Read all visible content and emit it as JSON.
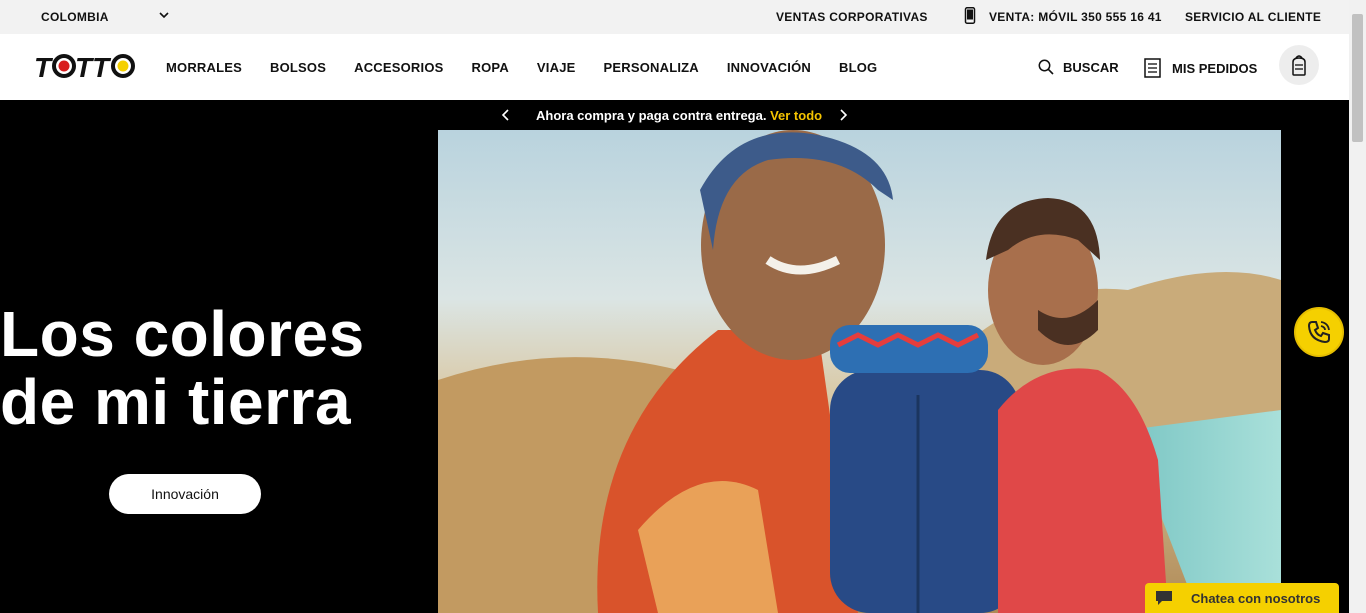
{
  "topbar": {
    "country": "COLOMBIA",
    "corporate_sales": "VENTAS CORPORATIVAS",
    "sales_phone": "VENTA: MÓVIL 350 555 16 41",
    "customer_service": "SERVICIO AL CLIENTE"
  },
  "header": {
    "logo_text": "TOTTO",
    "nav": [
      "MORRALES",
      "BOLSOS",
      "ACCESORIOS",
      "ROPA",
      "VIAJE",
      "PERSONALIZA",
      "INNOVACIÓN",
      "BLOG"
    ],
    "search_label": "BUSCAR",
    "orders_label": "MIS PEDIDOS"
  },
  "promo": {
    "message": "Ahora compra y paga contra entrega.",
    "link": "Ver todo"
  },
  "hero": {
    "headline_line1": "Los colores",
    "headline_line2": "de mi tierra",
    "cta_label": "Innovación"
  },
  "chat": {
    "label": "Chatea con nosotros"
  },
  "colors": {
    "brand_yellow": "#f5d000",
    "link_yellow": "#f5c400",
    "hero_bg": "#000000"
  }
}
